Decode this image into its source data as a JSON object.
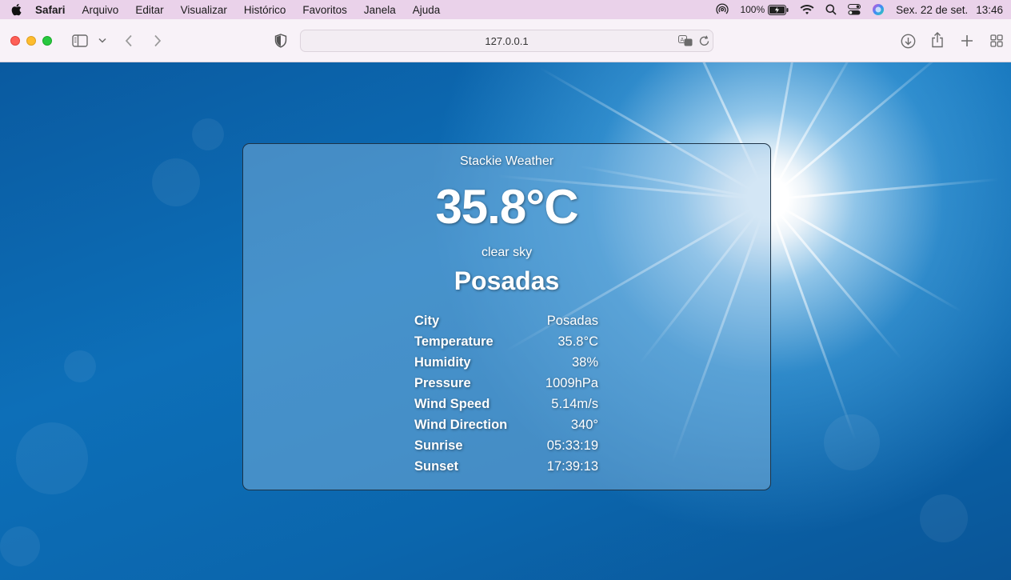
{
  "menubar": {
    "app_name": "Safari",
    "items": [
      "Arquivo",
      "Editar",
      "Visualizar",
      "Histórico",
      "Favoritos",
      "Janela",
      "Ajuda"
    ],
    "battery": "100%",
    "date": "Sex. 22 de set.",
    "time": "13:46"
  },
  "browser": {
    "url": "127.0.0.1"
  },
  "weather": {
    "app_title": "Stackie Weather",
    "temperature": "35.8°C",
    "description": "clear sky",
    "city": "Posadas",
    "details": [
      {
        "label": "City",
        "value": "Posadas"
      },
      {
        "label": "Temperature",
        "value": "35.8°C"
      },
      {
        "label": "Humidity",
        "value": "38%"
      },
      {
        "label": "Pressure",
        "value": "1009hPa"
      },
      {
        "label": "Wind Speed",
        "value": "5.14m/s"
      },
      {
        "label": "Wind Direction",
        "value": "340°"
      },
      {
        "label": "Sunrise",
        "value": "05:33:19"
      },
      {
        "label": "Sunset",
        "value": "17:39:13"
      }
    ]
  },
  "colors": {
    "menubar_bg": "#ead2ea",
    "toolbar_bg": "#f8f2f8",
    "sky_blue": "#0d6fb8"
  }
}
